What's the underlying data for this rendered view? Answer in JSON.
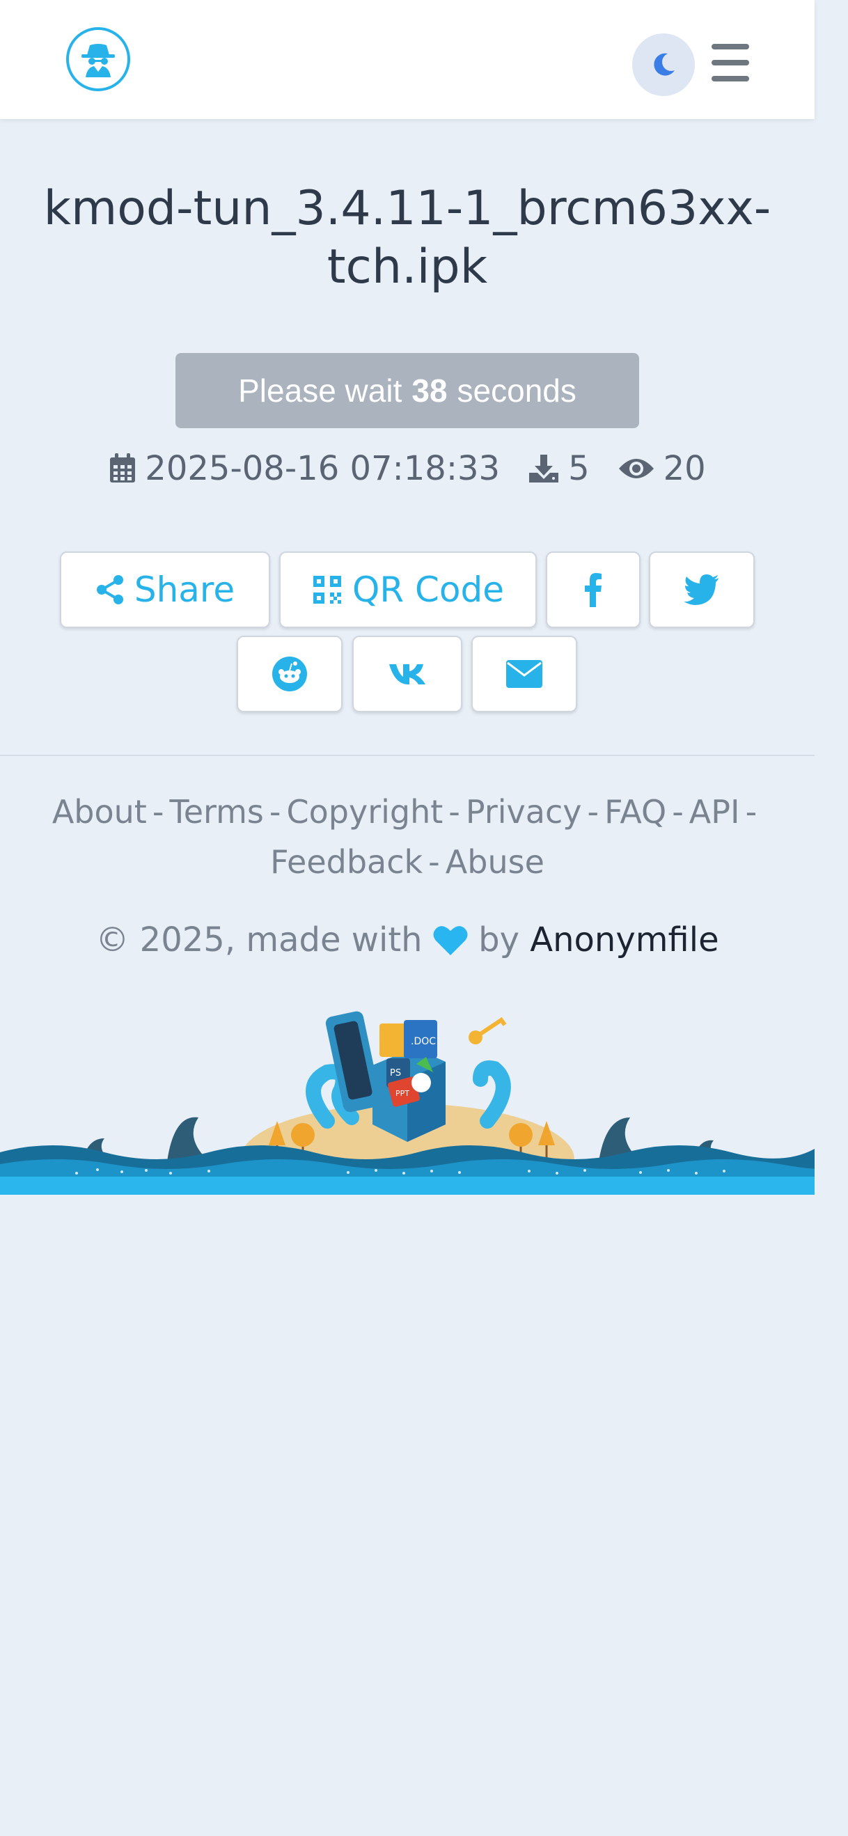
{
  "header": {
    "logo_icon": "incognito-spy-icon",
    "theme_toggle_icon": "moon-icon",
    "menu_icon": "hamburger-menu-icon"
  },
  "file": {
    "title_line1": "kmod-tun_3.4.11-1_brcm63xx-",
    "title_line2": "tch.ipk"
  },
  "download": {
    "wait_prefix": "Please wait",
    "wait_seconds": "38",
    "wait_suffix": "seconds"
  },
  "meta": {
    "date": "2025-08-16 07:18:33",
    "downloads": "5",
    "views": "20",
    "date_icon": "calendar-icon",
    "downloads_icon": "download-icon",
    "views_icon": "eye-icon"
  },
  "share": {
    "share_label": "Share",
    "qr_label": "QR Code",
    "icons": [
      "share-icon",
      "qrcode-icon",
      "facebook-icon",
      "twitter-icon",
      "reddit-icon",
      "vk-icon",
      "email-icon"
    ]
  },
  "footer": {
    "links": [
      "About",
      "Terms",
      "Copyright",
      "Privacy",
      "FAQ",
      "API",
      "Feedback",
      "Abuse"
    ],
    "copyright_prefix": "© 2025, made with",
    "copyright_by": "by",
    "brand": "Anonymfile"
  },
  "colors": {
    "accent": "#27b3ea",
    "background": "#e9eff7",
    "wait_button": "#aab3be",
    "heart": "#29b6f0"
  }
}
